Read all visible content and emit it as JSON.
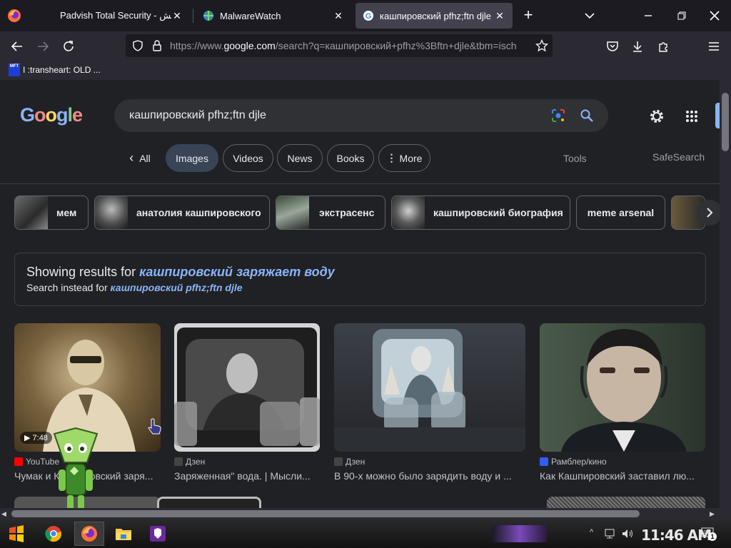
{
  "browser": {
    "tabs": [
      {
        "title": "Padvish Total Security - پادویش",
        "favicon": "padvish-icon",
        "active": false
      },
      {
        "title": "MalwareWatch",
        "favicon": "malwarewatch-icon",
        "active": false
      },
      {
        "title": "кашпировский pfhz;ftn djle",
        "favicon": "google-icon",
        "active": true
      }
    ],
    "new_tab_label": "+",
    "url_prefix": "https://www.",
    "url_domain": "google.com",
    "url_rest": "/search?q=кашпировский+pfhz%3Bftn+djle&tbm=isch",
    "bookmark": {
      "icon_text": "MFT",
      "label": "I :transheart: OLD ..."
    }
  },
  "google": {
    "logo": "Google",
    "query": "кашпировский pfhz;ftn djle",
    "nav_tabs": [
      {
        "label": "All",
        "selected": false,
        "prefix": "‹"
      },
      {
        "label": "Images",
        "selected": true
      },
      {
        "label": "Videos",
        "selected": false
      },
      {
        "label": "News",
        "selected": false
      },
      {
        "label": "Books",
        "selected": false
      },
      {
        "label": "More",
        "selected": false,
        "prefix": "⋮"
      }
    ],
    "tools_label": "Tools",
    "safesearch_label": "SafeSearch",
    "chips": [
      "мем",
      "анатолия кашпировского",
      "экстрасенс",
      "кашпировский биография",
      "meme arsenal"
    ],
    "correction": {
      "showing_prefix": "Showing results for ",
      "showing_query": "кашпировский заряжает воду",
      "instead_prefix": "Search instead for ",
      "instead_query": "кашпировский pfhz;ftn djle"
    },
    "results": [
      {
        "source": "YouTube",
        "title": "Чумак и Кашпировский заря...",
        "duration": "▶ 7:48",
        "favicon_color": "#ff0000"
      },
      {
        "source": "Дзен",
        "title": "Заряженная\" вода. | Мысли...",
        "favicon_color": "#444444"
      },
      {
        "source": "Дзен",
        "title": "В 90-х можно было зарядить воду и ...",
        "favicon_color": "#444444"
      },
      {
        "source": "Рамблер/кино",
        "title": "Как Кашпировский заставил лю...",
        "favicon_color": "#315efb"
      }
    ]
  },
  "taskbar": {
    "clock": "11:46 AM",
    "notification_count": "1"
  },
  "colors": {
    "link": "#8ab4f8",
    "page_bg": "#202124",
    "selected_tab": "#394457"
  }
}
